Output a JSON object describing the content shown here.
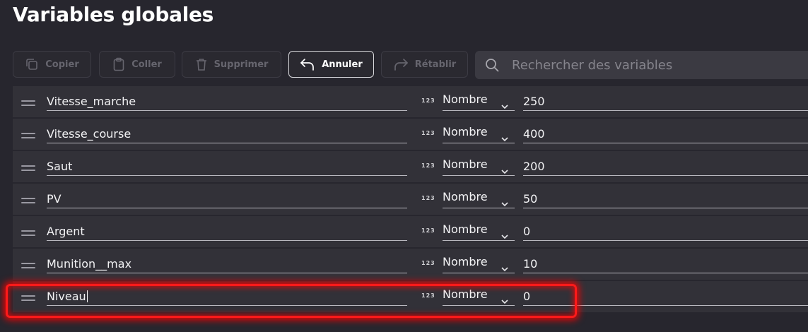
{
  "page": {
    "title": "Variables globales"
  },
  "toolbar": {
    "copy_label": "Copier",
    "paste_label": "Coller",
    "delete_label": "Supprimer",
    "undo_label": "Annuler",
    "redo_label": "Rétablir"
  },
  "search": {
    "placeholder": "Rechercher des variables"
  },
  "variables": [
    {
      "name": "Vitesse_marche",
      "type_icon": "123",
      "type": "Nombre",
      "value": "250"
    },
    {
      "name": "Vitesse_course",
      "type_icon": "123",
      "type": "Nombre",
      "value": "400"
    },
    {
      "name": "Saut",
      "type_icon": "123",
      "type": "Nombre",
      "value": "200"
    },
    {
      "name": "PV",
      "type_icon": "123",
      "type": "Nombre",
      "value": "50"
    },
    {
      "name": "Argent",
      "type_icon": "123",
      "type": "Nombre",
      "value": "0"
    },
    {
      "name": "Munition__max",
      "type_icon": "123",
      "type": "Nombre",
      "value": "10"
    },
    {
      "name": "Niveau",
      "type_icon": "123",
      "type": "Nombre",
      "value": "0"
    }
  ],
  "colors": {
    "background": "#27262e",
    "row": "#323138",
    "highlight": "#ff1a1a"
  }
}
